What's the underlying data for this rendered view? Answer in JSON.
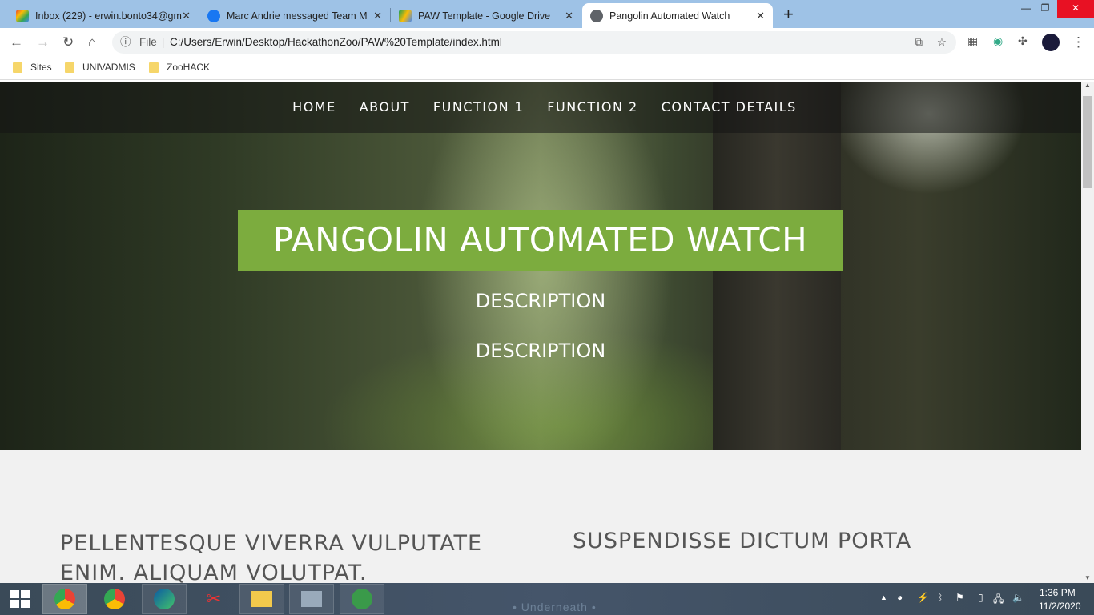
{
  "browser": {
    "tabs": [
      {
        "label": "Inbox (229) - erwin.bonto34@gm",
        "icon": "gmail-icon"
      },
      {
        "label": "Marc Andrie messaged Team MA",
        "icon": "facebook-icon"
      },
      {
        "label": "PAW Template - Google Drive",
        "icon": "google-drive-icon"
      },
      {
        "label": "Pangolin Automated Watch",
        "icon": "globe-icon"
      }
    ],
    "new_tab": "+",
    "address_prefix": "File",
    "url": "C:/Users/Erwin/Desktop/HackathonZoo/PAW%20Template/index.html",
    "bookmarks": [
      "Sites",
      "UNIVADMIS",
      "ZooHACK"
    ]
  },
  "site": {
    "nav": [
      "HOME",
      "ABOUT",
      "FUNCTION 1",
      "FUNCTION 2",
      "CONTACT DETAILS"
    ],
    "title": "PANGOLIN AUTOMATED WATCH",
    "descriptions": [
      "DESCRIPTION",
      "DESCRIPTION"
    ],
    "sections": [
      {
        "heading": "PELLENTESQUE VIVERRA VULPUTATE ENIM. ALIQUAM VOLUTPAT."
      },
      {
        "heading": "SUSPENDISSE DICTUM PORTA"
      }
    ],
    "accent": "#7cac3e"
  },
  "taskbar": {
    "time": "1:36 PM",
    "date": "11/2/2020",
    "wallpaper_text": "• Underneath •"
  }
}
